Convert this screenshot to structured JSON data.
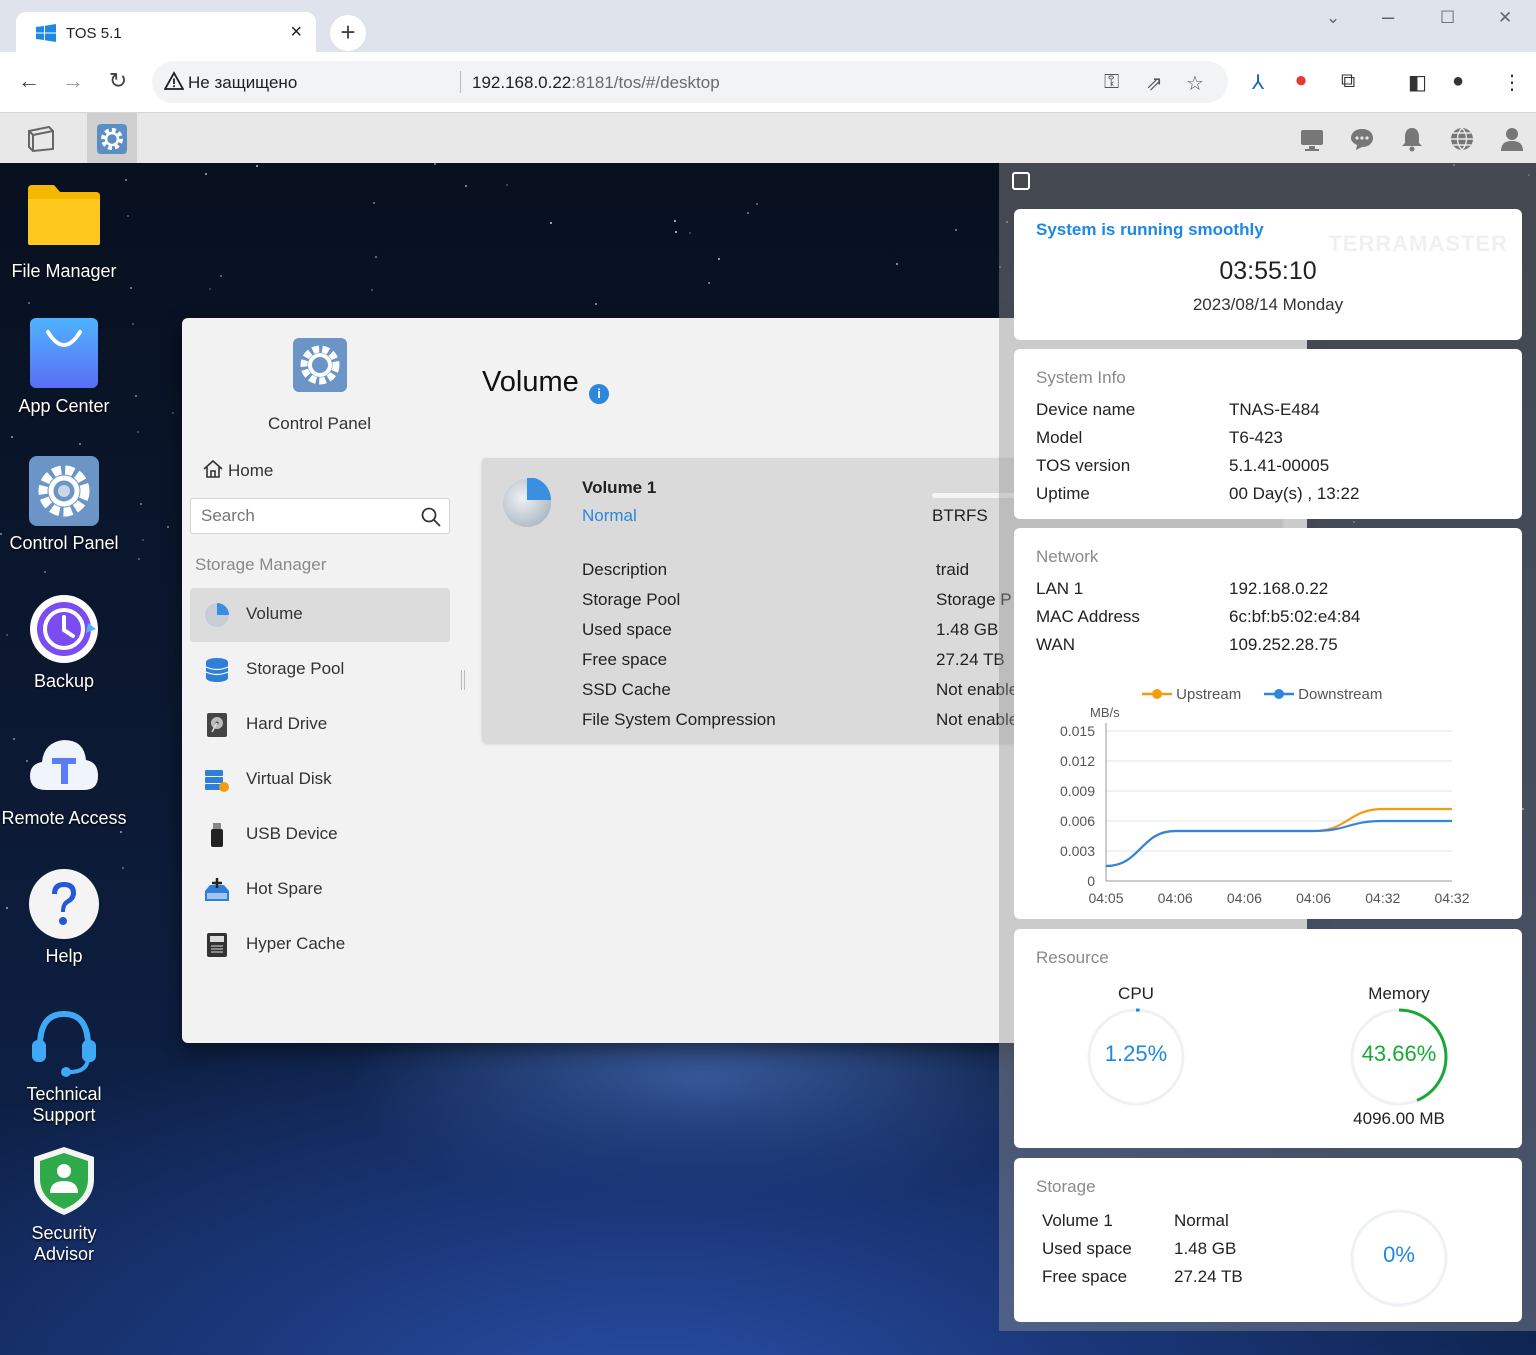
{
  "browser": {
    "tab_title": "TOS 5.1",
    "tab_close": "×",
    "new_tab": "+",
    "security_label": "Не защищено",
    "url_host": "192.168.0.22",
    "url_rest": ":8181/tos/#/desktop"
  },
  "desktop": {
    "icons": [
      {
        "label": "File Manager"
      },
      {
        "label": "App Center"
      },
      {
        "label": "Control Panel"
      },
      {
        "label": "Backup"
      },
      {
        "label": "Remote Access"
      },
      {
        "label": "Help"
      },
      {
        "label": "Technical\nSupport"
      },
      {
        "label": "Security\nAdvisor"
      }
    ]
  },
  "control_panel": {
    "title": "Control Panel",
    "home": "Home",
    "search_placeholder": "Search",
    "group": "Storage Manager",
    "items": [
      {
        "label": "Volume",
        "icon": "volume-icon"
      },
      {
        "label": "Storage Pool",
        "icon": "storage-pool-icon"
      },
      {
        "label": "Hard Drive",
        "icon": "hard-drive-icon"
      },
      {
        "label": "Virtual Disk",
        "icon": "virtual-disk-icon"
      },
      {
        "label": "USB Device",
        "icon": "usb-icon"
      },
      {
        "label": "Hot Spare",
        "icon": "hot-spare-icon"
      },
      {
        "label": "Hyper Cache",
        "icon": "hyper-cache-icon"
      }
    ],
    "page_title": "Volume",
    "info": "i",
    "volume": {
      "name": "Volume 1",
      "status": "Normal",
      "fs": "BTRFS",
      "rows": [
        {
          "label": "Description",
          "value": "traid"
        },
        {
          "label": "Storage Pool",
          "value": "Storage P"
        },
        {
          "label": "Used space",
          "value": "1.48 GB"
        },
        {
          "label": "Free space",
          "value": "27.24 TB"
        },
        {
          "label": "SSD Cache",
          "value": "Not enable"
        },
        {
          "label": "File System Compression",
          "value": "Not enable"
        }
      ]
    }
  },
  "widgets": {
    "status": {
      "message": "System is running smoothly",
      "time": "03:55:10",
      "date": "2023/08/14 Monday",
      "watermark": "TERRAMASTER"
    },
    "system_info": {
      "title": "System Info",
      "rows": [
        {
          "label": "Device name",
          "value": "TNAS-E484"
        },
        {
          "label": "Model",
          "value": "T6-423"
        },
        {
          "label": "TOS version",
          "value": "5.1.41-00005"
        },
        {
          "label": "Uptime",
          "value": "00 Day(s) , 13:22"
        }
      ]
    },
    "network": {
      "title": "Network",
      "rows": [
        {
          "label": "LAN 1",
          "value": "192.168.0.22"
        },
        {
          "label": "MAC Address",
          "value": "6c:bf:b5:02:e4:84"
        },
        {
          "label": "WAN",
          "value": "109.252.28.75"
        }
      ]
    },
    "resource": {
      "title": "Resource",
      "cpu_label": "CPU",
      "cpu_value": "1.25%",
      "cpu_fraction": 0.0125,
      "memory_label": "Memory",
      "memory_value": "43.66%",
      "memory_fraction": 0.4366,
      "memory_total": "4096.00 MB"
    },
    "storage": {
      "title": "Storage",
      "rows": [
        {
          "label": "Volume 1",
          "value": "Normal"
        },
        {
          "label": "Used space",
          "value": "1.48 GB"
        },
        {
          "label": "Free space",
          "value": "27.24 TB"
        }
      ],
      "usage": "0%"
    }
  },
  "chart_data": {
    "type": "line",
    "ylabel": "MB/s",
    "x": [
      "04:05",
      "04:06",
      "04:06",
      "04:06",
      "04:32",
      "04:32"
    ],
    "yticks": [
      "0",
      "0.003",
      "0.006",
      "0.009",
      "0.012",
      "0.015"
    ],
    "ylim": [
      0,
      0.015
    ],
    "legend_position": "top",
    "grid": true,
    "series": [
      {
        "name": "Upstream",
        "color": "#f39c12",
        "values": [
          0.0015,
          0.005,
          0.005,
          0.005,
          0.0072,
          0.0072
        ]
      },
      {
        "name": "Downstream",
        "color": "#2e86de",
        "values": [
          0.0015,
          0.005,
          0.005,
          0.005,
          0.006,
          0.006
        ]
      }
    ]
  }
}
